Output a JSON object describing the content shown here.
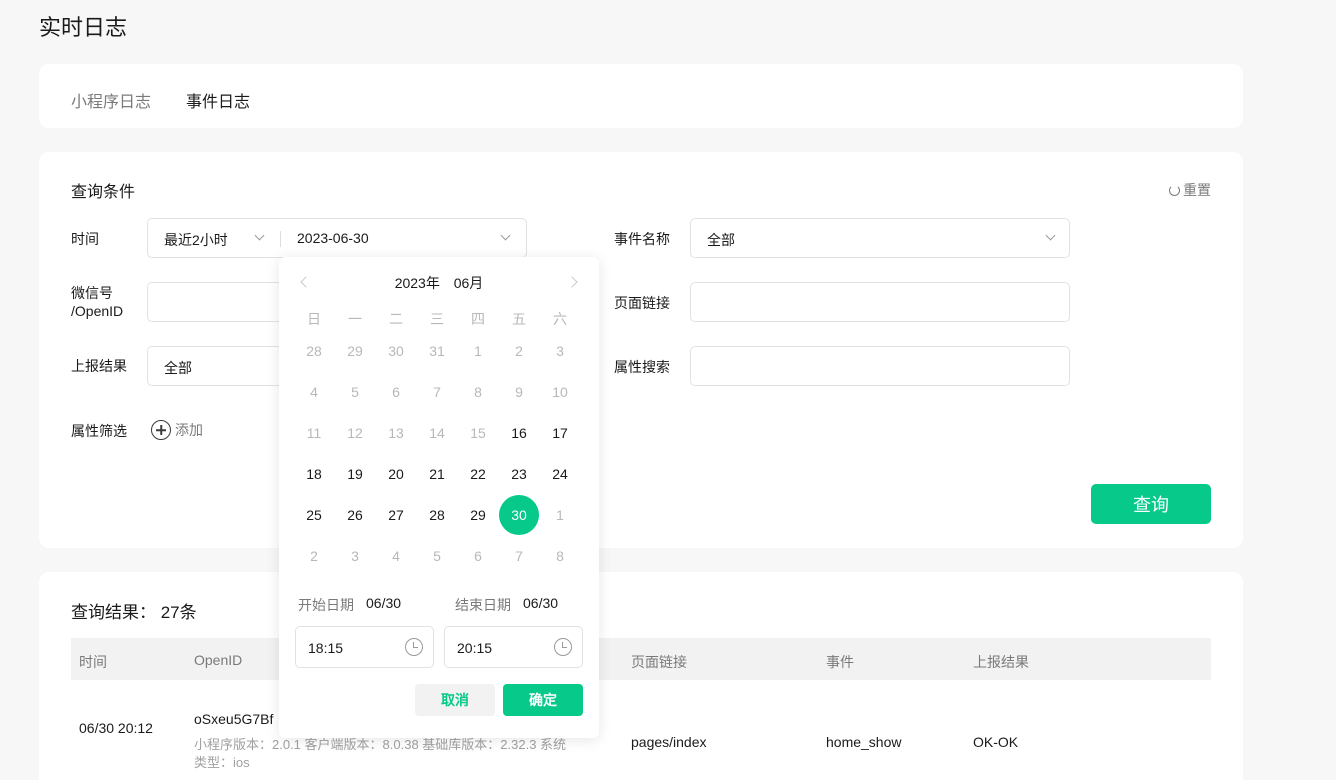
{
  "page": {
    "title": "实时日志"
  },
  "tabs": [
    {
      "label": "小程序日志"
    },
    {
      "label": "事件日志"
    }
  ],
  "query": {
    "title": "查询条件",
    "reset_label": "重置",
    "time_label": "时间",
    "time_range": "最近2小时",
    "date_value": "2023-06-30",
    "wechat_label_line1": "微信号",
    "wechat_label_line2": "/OpenID",
    "wechat_value": "",
    "report_label": "上报结果",
    "report_value": "全部",
    "attr_filter_label": "属性筛选",
    "add_label": "添加",
    "event_name_label": "事件名称",
    "event_name_value": "全部",
    "page_link_label": "页面链接",
    "page_link_value": "",
    "attr_search_label": "属性搜索",
    "attr_search_value": "",
    "submit_label": "查询"
  },
  "results": {
    "title": "查询结果： 27条",
    "columns": [
      "时间",
      "OpenID",
      "页面链接",
      "事件",
      "上报结果"
    ],
    "rows": [
      {
        "time": "06/30 20:12",
        "openid": "oSxeu5G7Bf",
        "info_line1": "小程序版本：2.0.1 客户端版本：8.0.38 基础库版本：2.32.3 系统",
        "info_line2": "类型：ios",
        "page": "pages/index",
        "event": "home_show",
        "result": "OK-OK"
      }
    ]
  },
  "datepicker": {
    "year": "2023年",
    "month": "06月",
    "weekdays": [
      "日",
      "一",
      "二",
      "三",
      "四",
      "五",
      "六"
    ],
    "weeks": [
      [
        {
          "d": "28",
          "s": "muted"
        },
        {
          "d": "29",
          "s": "muted"
        },
        {
          "d": "30",
          "s": "muted"
        },
        {
          "d": "31",
          "s": "muted"
        },
        {
          "d": "1",
          "s": "muted"
        },
        {
          "d": "2",
          "s": "muted"
        },
        {
          "d": "3",
          "s": "muted"
        }
      ],
      [
        {
          "d": "4",
          "s": "muted"
        },
        {
          "d": "5",
          "s": "muted"
        },
        {
          "d": "6",
          "s": "muted"
        },
        {
          "d": "7",
          "s": "muted"
        },
        {
          "d": "8",
          "s": "muted"
        },
        {
          "d": "9",
          "s": "muted"
        },
        {
          "d": "10",
          "s": "muted"
        }
      ],
      [
        {
          "d": "11",
          "s": "muted"
        },
        {
          "d": "12",
          "s": "muted"
        },
        {
          "d": "13",
          "s": "muted"
        },
        {
          "d": "14",
          "s": "muted"
        },
        {
          "d": "15",
          "s": "muted"
        },
        {
          "d": "16",
          "s": "active"
        },
        {
          "d": "17",
          "s": "active"
        }
      ],
      [
        {
          "d": "18",
          "s": "active"
        },
        {
          "d": "19",
          "s": "active"
        },
        {
          "d": "20",
          "s": "active"
        },
        {
          "d": "21",
          "s": "active"
        },
        {
          "d": "22",
          "s": "active"
        },
        {
          "d": "23",
          "s": "active"
        },
        {
          "d": "24",
          "s": "active"
        }
      ],
      [
        {
          "d": "25",
          "s": "active"
        },
        {
          "d": "26",
          "s": "active"
        },
        {
          "d": "27",
          "s": "active"
        },
        {
          "d": "28",
          "s": "active"
        },
        {
          "d": "29",
          "s": "active"
        },
        {
          "d": "30",
          "s": "selected"
        },
        {
          "d": "1",
          "s": "muted"
        }
      ],
      [
        {
          "d": "2",
          "s": "muted"
        },
        {
          "d": "3",
          "s": "muted"
        },
        {
          "d": "4",
          "s": "muted"
        },
        {
          "d": "5",
          "s": "muted"
        },
        {
          "d": "6",
          "s": "muted"
        },
        {
          "d": "7",
          "s": "muted"
        },
        {
          "d": "8",
          "s": "muted"
        }
      ]
    ],
    "start_label": "开始日期",
    "start_value": "06/30",
    "end_label": "结束日期",
    "end_value": "06/30",
    "start_time": "18:15",
    "end_time": "20:15",
    "cancel_label": "取消",
    "confirm_label": "确定"
  },
  "colors": {
    "accent": "#07c98a",
    "background": "#f7f7f7",
    "muted_text": "#7a7a7a"
  }
}
